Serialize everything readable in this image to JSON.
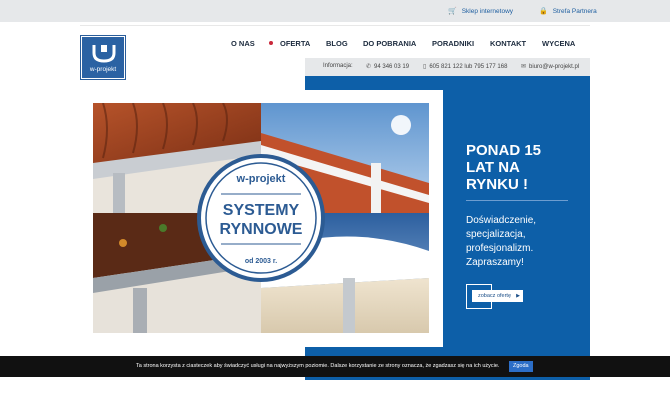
{
  "topbar": {
    "shop_label": "Sklep internetowy",
    "partner_label": "Strefa Partnera",
    "shop_icon": "cart-icon",
    "partner_icon": "lock-icon"
  },
  "logo": {
    "text": "w-projekt"
  },
  "nav": {
    "items": [
      {
        "label": "O NAS"
      },
      {
        "label": "OFERTA"
      },
      {
        "label": "BLOG"
      },
      {
        "label": "DO POBRANIA"
      },
      {
        "label": "PORADNIKI"
      },
      {
        "label": "KONTAKT"
      },
      {
        "label": "WYCENA"
      }
    ]
  },
  "info": {
    "label": "Informacja:",
    "phone": "94 346 03 19",
    "mobile1": "605 821 122",
    "or": "lub",
    "mobile2": "795 177 168",
    "email": "biuro@w-projekt.pl"
  },
  "hero": {
    "badge_top": "w-projekt",
    "badge_line1": "SYSTEMY",
    "badge_line2": "RYNNOWE",
    "badge_bottom": "od 2003 r.",
    "slogan_line1": "PONAD 15",
    "slogan_line2": "LAT NA",
    "slogan_line3": "RYNKU !",
    "desc_line1": "Doświadczenie,",
    "desc_line2": "specjalizacja,",
    "desc_line3": "profesjonalizm.",
    "desc_line4": "Zapraszamy!",
    "cta_label": "zobacz ofertę"
  },
  "cookie": {
    "message": "Ta strona korzysta z ciasteczek aby świadczyć usługi na najwyższym poziomie. Dalsze korzystanie ze strony oznacza, że zgadzasz się na ich użycie.",
    "button": "Zgoda"
  },
  "colors": {
    "brand_blue": "#0d5fa8",
    "nav_text": "#1c2b3e",
    "accent_red": "#c9283b"
  }
}
